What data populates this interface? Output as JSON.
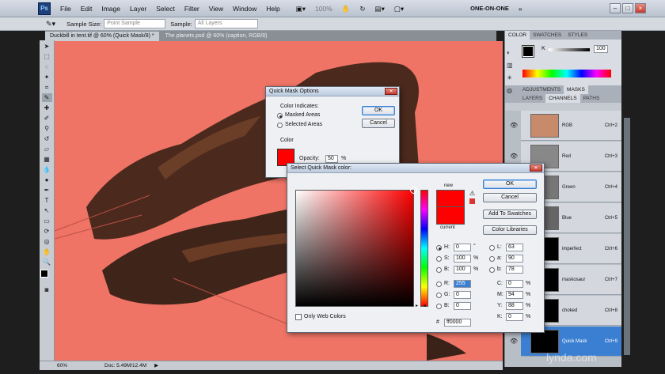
{
  "menubar": {
    "logo": "Ps",
    "items": [
      "File",
      "Edit",
      "Image",
      "Layer",
      "Select",
      "Filter",
      "View",
      "Window",
      "Help"
    ],
    "zoom": "100%",
    "workspace": "ONE-ON-ONE"
  },
  "options": {
    "sample_size_label": "Sample Size:",
    "sample_size_value": "Point Sample",
    "sample_label": "Sample:",
    "sample_value": "All Layers"
  },
  "doc_tabs": [
    {
      "label": "Duckbill in tent.tif @ 60% (Quick Mask/8) *"
    },
    {
      "label": "The planets.psd @ 60% (caption, RGB/8)"
    }
  ],
  "status": {
    "zoom": "60%",
    "doc": "Doc: 5.49M/12.4M"
  },
  "panels": {
    "top_tabs": [
      "COLOR",
      "SWATCHES",
      "STYLES"
    ],
    "k_label": "K",
    "k_value": "100",
    "adj_tabs": [
      "ADJUSTMENTS",
      "MASKS"
    ],
    "ch_tabs": [
      "LAYERS",
      "CHANNELS",
      "PATHS"
    ],
    "channels": [
      {
        "name": "RGB",
        "shortcut": "Ctrl+2"
      },
      {
        "name": "Red",
        "shortcut": "Ctrl+3"
      },
      {
        "name": "Green",
        "shortcut": "Ctrl+4"
      },
      {
        "name": "Blue",
        "shortcut": "Ctrl+5"
      },
      {
        "name": "imperfect",
        "shortcut": "Ctrl+6"
      },
      {
        "name": "maskosaur",
        "shortcut": "Ctrl+7"
      },
      {
        "name": "choked",
        "shortcut": "Ctrl+8"
      },
      {
        "name": "Quick Mask",
        "shortcut": "Ctrl+9"
      }
    ]
  },
  "quickmask": {
    "title": "Quick Mask Options",
    "group_label": "Color Indicates:",
    "opt_masked": "Masked Areas",
    "opt_selected": "Selected Areas",
    "color_group": "Color",
    "opacity_label": "Opacity:",
    "opacity_value": "50",
    "opacity_unit": "%",
    "ok": "OK",
    "cancel": "Cancel",
    "mask_color": "#ff0000"
  },
  "picker": {
    "title": "Select Quick Mask color:",
    "ok": "OK",
    "cancel": "Cancel",
    "add_swatches": "Add To Swatches",
    "libraries": "Color Libraries",
    "new_label": "new",
    "current_label": "current",
    "only_web": "Only Web Colors",
    "fields": {
      "H": "0",
      "S": "100",
      "B": "100",
      "R": "255",
      "G": "0",
      "Bl": "0",
      "L": "63",
      "a": "90",
      "b": "78",
      "C": "0",
      "M": "94",
      "Y": "88",
      "K": "0",
      "hex": "ff0000"
    },
    "units": {
      "deg": "°",
      "pct": "%"
    }
  },
  "watermark": "lynda.com",
  "colors": {
    "canvas_red": "#ef7466",
    "selection_blue": "#3b7fd2"
  }
}
